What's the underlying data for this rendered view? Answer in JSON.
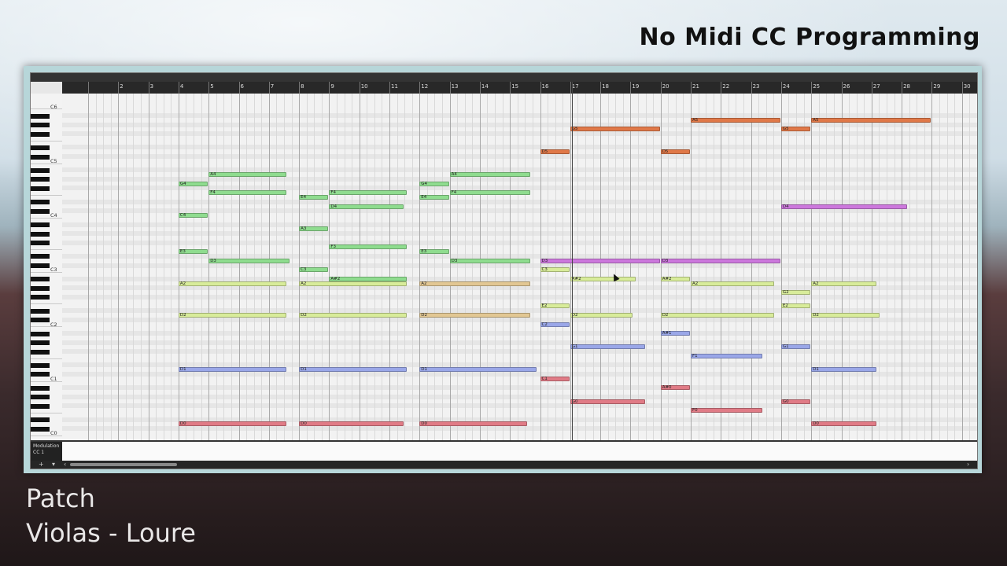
{
  "overlay": {
    "headline": "No Midi CC Programming",
    "patch_label": "Patch",
    "patch_name": "Violas - Loure"
  },
  "ruler": {
    "bars": [
      "2",
      "3",
      "4",
      "5",
      "6",
      "7",
      "8",
      "9",
      "10",
      "11",
      "12",
      "13",
      "14",
      "15",
      "16",
      "17",
      "18",
      "19",
      "20",
      "21",
      "22",
      "23",
      "24",
      "25",
      "26",
      "27",
      "28",
      "29",
      "30",
      "31"
    ]
  },
  "keyboard": {
    "octave_labels": [
      "C6",
      "C5",
      "C4",
      "C3",
      "C2",
      "C1",
      "C0"
    ]
  },
  "controller_lane": {
    "line1": "Modulation",
    "line2": "CC 1"
  },
  "bottom_bar": {
    "add": "+",
    "menu": "▾",
    "left": "‹",
    "right": "›"
  },
  "colors": {
    "orange": "#e07848",
    "green": "#8fdc8f",
    "lime": "#d8ec9a",
    "tan": "#e2c793",
    "purple": "#cc78dc",
    "blue": "#9aa7e8",
    "red": "#e07b86",
    "teal": "#6fd6d0"
  },
  "notes": [
    {
      "label": "A5",
      "bar": 21,
      "len": 3,
      "color": "orange"
    },
    {
      "label": "A5",
      "bar": 25,
      "len": 4,
      "color": "orange"
    },
    {
      "label": "G5",
      "bar": 17,
      "len": 3,
      "color": "orange"
    },
    {
      "label": "G5",
      "bar": 24,
      "len": 1,
      "color": "orange"
    },
    {
      "label": "D5",
      "bar": 16,
      "len": 1,
      "color": "orange"
    },
    {
      "label": "D5",
      "bar": 20,
      "len": 1,
      "color": "orange"
    },
    {
      "label": "A4",
      "bar": 5,
      "len": 2.6,
      "color": "green"
    },
    {
      "label": "A4",
      "bar": 13,
      "len": 2.7,
      "color": "green"
    },
    {
      "label": "G4",
      "bar": 4,
      "len": 1,
      "color": "green"
    },
    {
      "label": "G4",
      "bar": 12,
      "len": 1,
      "color": "green"
    },
    {
      "label": "F4",
      "bar": 5,
      "len": 2.6,
      "color": "green"
    },
    {
      "label": "F4",
      "bar": 9,
      "len": 2.6,
      "color": "green"
    },
    {
      "label": "F4",
      "bar": 13,
      "len": 2.7,
      "color": "green"
    },
    {
      "label": "E4",
      "bar": 8,
      "len": 1,
      "color": "green"
    },
    {
      "label": "E4",
      "bar": 12,
      "len": 1,
      "color": "green"
    },
    {
      "label": "D4",
      "bar": 9,
      "len": 2.5,
      "color": "green"
    },
    {
      "label": "D4",
      "bar": 24,
      "len": 4.2,
      "color": "purple"
    },
    {
      "label": "C4",
      "bar": 4,
      "len": 1,
      "color": "green"
    },
    {
      "label": "A3",
      "bar": 8,
      "len": 1,
      "color": "green"
    },
    {
      "label": "F3",
      "bar": 9,
      "len": 2.6,
      "color": "green"
    },
    {
      "label": "E3",
      "bar": 4,
      "len": 1,
      "color": "green"
    },
    {
      "label": "E3",
      "bar": 12,
      "len": 1,
      "color": "green"
    },
    {
      "label": "D3",
      "bar": 5,
      "len": 2.7,
      "color": "green"
    },
    {
      "label": "D3",
      "bar": 13,
      "len": 2.7,
      "color": "green"
    },
    {
      "label": "D3",
      "bar": 16,
      "len": 4,
      "color": "purple"
    },
    {
      "label": "D3",
      "bar": 20,
      "len": 4,
      "color": "purple"
    },
    {
      "label": "C3",
      "bar": 8,
      "len": 1,
      "color": "green"
    },
    {
      "label": "C3",
      "bar": 16,
      "len": 1,
      "color": "lime"
    },
    {
      "label": "A#2",
      "bar": 9,
      "len": 2.6,
      "color": "green"
    },
    {
      "label": "A#2",
      "bar": 17,
      "len": 2.2,
      "color": "lime"
    },
    {
      "label": "A#2",
      "bar": 20,
      "len": 1,
      "color": "lime"
    },
    {
      "label": "A2",
      "bar": 4,
      "len": 3.6,
      "color": "lime"
    },
    {
      "label": "A2",
      "bar": 8,
      "len": 3.6,
      "color": "lime"
    },
    {
      "label": "A2",
      "bar": 12,
      "len": 3.7,
      "color": "tan"
    },
    {
      "label": "A2",
      "bar": 21,
      "len": 2.8,
      "color": "lime"
    },
    {
      "label": "A2",
      "bar": 25,
      "len": 2.2,
      "color": "lime"
    },
    {
      "label": "G2",
      "bar": 24,
      "len": 1,
      "color": "lime"
    },
    {
      "label": "E2",
      "bar": 16,
      "len": 1,
      "color": "lime"
    },
    {
      "label": "E2",
      "bar": 24,
      "len": 1,
      "color": "lime"
    },
    {
      "label": "D2",
      "bar": 4,
      "len": 3.6,
      "color": "lime"
    },
    {
      "label": "D2",
      "bar": 8,
      "len": 3.6,
      "color": "lime"
    },
    {
      "label": "D2",
      "bar": 12,
      "len": 3.7,
      "color": "tan"
    },
    {
      "label": "D2",
      "bar": 17,
      "len": 2.1,
      "color": "lime"
    },
    {
      "label": "D2",
      "bar": 20,
      "len": 3.8,
      "color": "lime"
    },
    {
      "label": "D2",
      "bar": 25,
      "len": 2.3,
      "color": "lime"
    },
    {
      "label": "C2",
      "bar": 16,
      "len": 1,
      "color": "blue"
    },
    {
      "label": "A#1",
      "bar": 20,
      "len": 1,
      "color": "blue"
    },
    {
      "label": "G1",
      "bar": 17,
      "len": 2.5,
      "color": "blue"
    },
    {
      "label": "G1",
      "bar": 24,
      "len": 1,
      "color": "blue"
    },
    {
      "label": "F1",
      "bar": 21,
      "len": 2.4,
      "color": "blue"
    },
    {
      "label": "D1",
      "bar": 4,
      "len": 3.6,
      "color": "blue"
    },
    {
      "label": "D1",
      "bar": 8,
      "len": 3.6,
      "color": "blue"
    },
    {
      "label": "D1",
      "bar": 12,
      "len": 3.9,
      "color": "blue"
    },
    {
      "label": "D1",
      "bar": 25,
      "len": 2.2,
      "color": "blue"
    },
    {
      "label": "C1",
      "bar": 16,
      "len": 1,
      "color": "red"
    },
    {
      "label": "A#0",
      "bar": 20,
      "len": 1,
      "color": "red"
    },
    {
      "label": "G0",
      "bar": 17,
      "len": 2.5,
      "color": "red"
    },
    {
      "label": "G0",
      "bar": 24,
      "len": 1,
      "color": "red"
    },
    {
      "label": "F0",
      "bar": 21,
      "len": 2.4,
      "color": "red"
    },
    {
      "label": "D0",
      "bar": 4,
      "len": 3.6,
      "color": "red"
    },
    {
      "label": "D0",
      "bar": 8,
      "len": 3.5,
      "color": "red"
    },
    {
      "label": "D0",
      "bar": 12,
      "len": 3.6,
      "color": "red"
    },
    {
      "label": "D0",
      "bar": 25,
      "len": 2.2,
      "color": "red"
    }
  ]
}
